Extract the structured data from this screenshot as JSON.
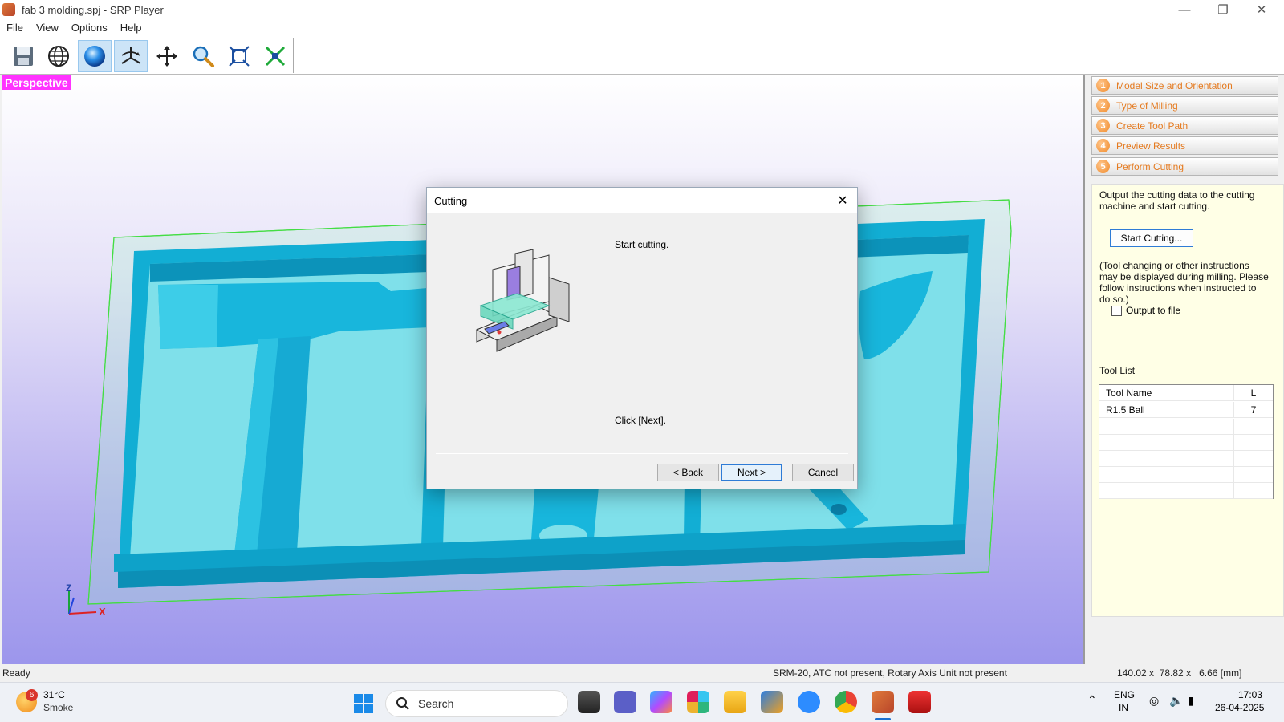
{
  "window": {
    "title": "fab 3 molding.spj - SRP Player"
  },
  "menu": [
    "File",
    "View",
    "Options",
    "Help"
  ],
  "toolbar": {
    "icons": [
      "save-icon",
      "globe-icon",
      "sphere-icon",
      "rotate-axes-icon",
      "pan-icon",
      "zoom-icon",
      "fit-view-icon",
      "zoom-extents-icon"
    ],
    "active": [
      "sphere-icon",
      "rotate-axes-icon"
    ]
  },
  "viewport": {
    "view_label": "Perspective",
    "axis_z": "Z",
    "axis_x": "X"
  },
  "steps": [
    {
      "num": "1",
      "label": "Model Size and Orientation"
    },
    {
      "num": "2",
      "label": "Type of Milling"
    },
    {
      "num": "3",
      "label": "Create Tool Path"
    },
    {
      "num": "4",
      "label": "Preview Results"
    },
    {
      "num": "5",
      "label": "Perform Cutting"
    }
  ],
  "panel": {
    "description_1": "Output the cutting data to the cutting",
    "description_2": "machine and start cutting.",
    "start_button": "Start Cutting...",
    "note_1": "(Tool changing or other instructions",
    "note_2": "may be displayed during milling. Please",
    "note_3": "follow instructions when instructed to",
    "note_4": "do so.)",
    "output_to_file": "Output to file",
    "tool_list_label": "Tool List",
    "tool_table": {
      "headers": [
        "Tool Name",
        "L"
      ],
      "rows": [
        [
          "R1.5 Ball",
          "7"
        ]
      ]
    }
  },
  "dialog": {
    "title": "Cutting",
    "message": "Start cutting.",
    "instruction": "Click [Next].",
    "back": "< Back",
    "next": "Next >",
    "cancel": "Cancel"
  },
  "statusbar": {
    "left": "Ready",
    "machine": "SRM-20, ATC not present, Rotary Axis Unit not present",
    "size": "140.02 x  78.82 x   6.66 [mm]"
  },
  "taskbar": {
    "weather_badge": "6",
    "weather_temp": "31°C",
    "weather_cond": "Smoke",
    "search": "Search",
    "lang_1": "ENG",
    "lang_2": "IN",
    "time": "17:03",
    "date": "26-04-2025"
  },
  "colors": {
    "accent": "#2e7bd6",
    "step_text": "#e57a1f",
    "view_label_bg": "#ff33ff",
    "model": "#10b4d8",
    "bounding_box": "#44dd44"
  }
}
